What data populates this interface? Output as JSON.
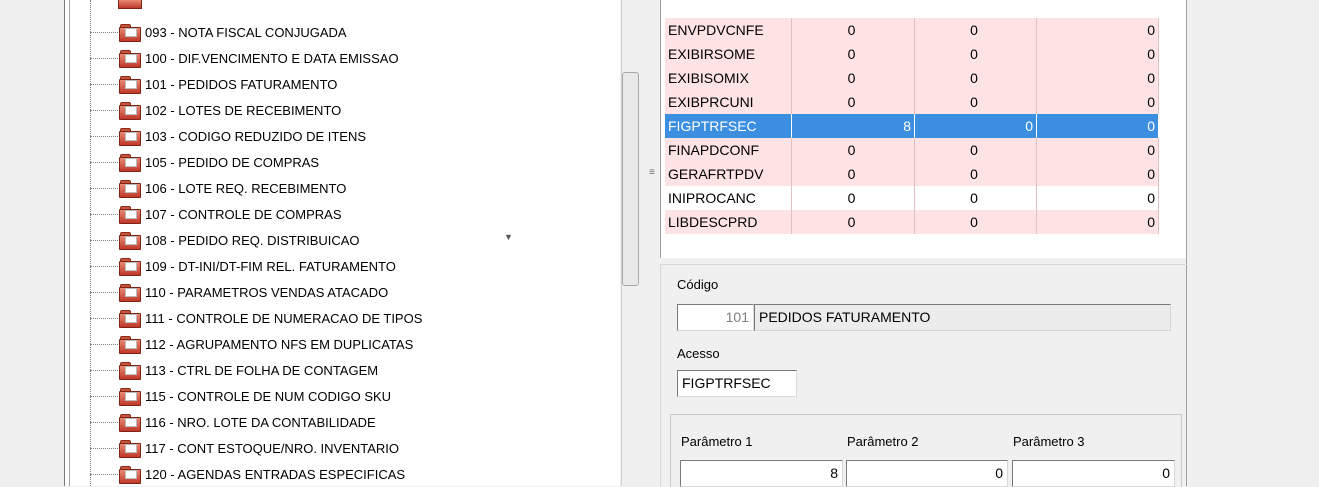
{
  "tree": {
    "items": [
      {
        "label": "093 - NOTA FISCAL CONJUGADA"
      },
      {
        "label": "100 - DIF.VENCIMENTO E DATA EMISSAO"
      },
      {
        "label": "101 - PEDIDOS FATURAMENTO"
      },
      {
        "label": "102 - LOTES DE RECEBIMENTO"
      },
      {
        "label": "103 - CODIGO REDUZIDO DE ITENS"
      },
      {
        "label": "105 - PEDIDO DE COMPRAS"
      },
      {
        "label": "106 - LOTE REQ. RECEBIMENTO"
      },
      {
        "label": "107 - CONTROLE DE COMPRAS"
      },
      {
        "label": "108 - PEDIDO REQ. DISTRIBUICAO"
      },
      {
        "label": "109 - DT-INI/DT-FIM REL. FATURAMENTO"
      },
      {
        "label": "110 - PARAMETROS VENDAS ATACADO"
      },
      {
        "label": "111 - CONTROLE DE NUMERACAO DE TIPOS"
      },
      {
        "label": "112 - AGRUPAMENTO NFS EM DUPLICATAS"
      },
      {
        "label": "113 - CTRL DE FOLHA DE CONTAGEM"
      },
      {
        "label": "115 - CONTROLE DE NUM CODIGO SKU"
      },
      {
        "label": "116 - NRO. LOTE DA CONTABILIDADE"
      },
      {
        "label": "117 - CONT ESTOQUE/NRO. INVENTARIO"
      },
      {
        "label": "120 - AGENDAS ENTRADAS ESPECIFICAS"
      }
    ],
    "icon": "folder-icon"
  },
  "grid": {
    "rows": [
      {
        "code": "ENVPDVCNFE",
        "p1": "0",
        "p2": "0",
        "p3": "0",
        "state": "pink"
      },
      {
        "code": "EXIBIRSOME",
        "p1": "0",
        "p2": "0",
        "p3": "0",
        "state": "pink"
      },
      {
        "code": "EXIBISOMIX",
        "p1": "0",
        "p2": "0",
        "p3": "0",
        "state": "pink"
      },
      {
        "code": "EXIBPRCUNI",
        "p1": "0",
        "p2": "0",
        "p3": "0",
        "state": "pink"
      },
      {
        "code": "FIGPTRFSEC",
        "p1": "8",
        "p2": "0",
        "p3": "0",
        "state": "selected"
      },
      {
        "code": "FINAPDCONF",
        "p1": "0",
        "p2": "0",
        "p3": "0",
        "state": "pink"
      },
      {
        "code": "GERAFRTPDV",
        "p1": "0",
        "p2": "0",
        "p3": "0",
        "state": "pink"
      },
      {
        "code": "INIPROCANC",
        "p1": "0",
        "p2": "0",
        "p3": "0",
        "state": "white"
      },
      {
        "code": "LIBDESCPRD",
        "p1": "0",
        "p2": "0",
        "p3": "0",
        "state": "pink"
      }
    ],
    "colors": {
      "selected": "#3c8fe0",
      "pink": "#fde3e3"
    }
  },
  "form": {
    "codigo_label": "Código",
    "codigo_value": "101",
    "codigo_desc": "PEDIDOS FATURAMENTO",
    "acesso_label": "Acesso",
    "acesso_value": "FIGPTRFSEC",
    "param1_label": "Parâmetro 1",
    "param1_value": "8",
    "param2_label": "Parâmetro 2",
    "param2_value": "0",
    "param3_label": "Parâmetro 3",
    "param3_value": "0"
  }
}
